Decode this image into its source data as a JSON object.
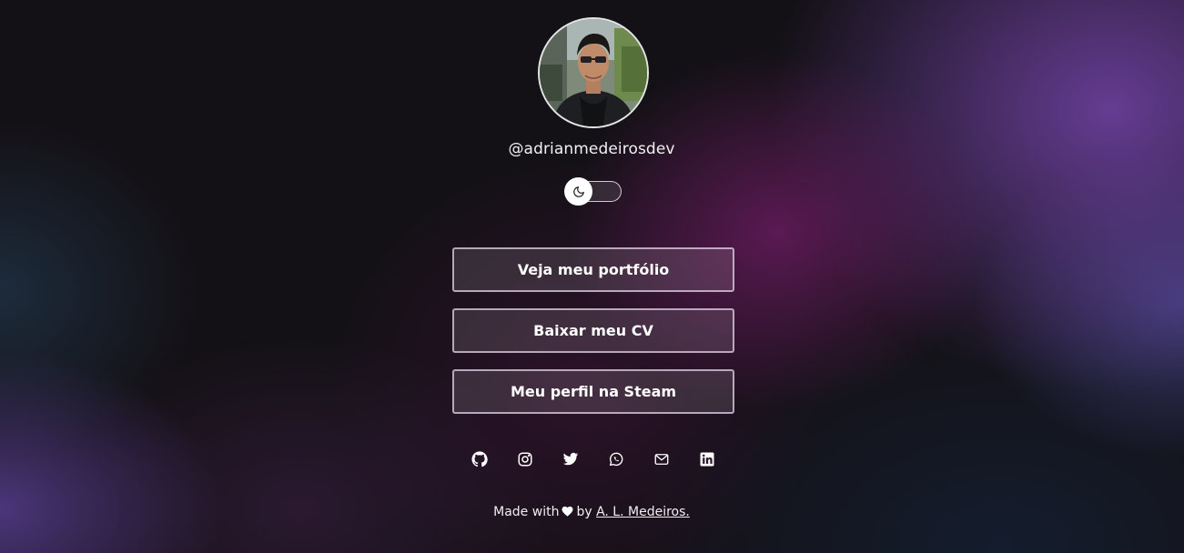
{
  "profile": {
    "username": "@adrianmedeirosdev"
  },
  "theme_toggle": {
    "icon": "moon-icon",
    "state": "dark"
  },
  "links": [
    {
      "label": "Veja meu portfólio"
    },
    {
      "label": "Baixar meu CV"
    },
    {
      "label": "Meu perfil na Steam"
    }
  ],
  "socials": [
    {
      "icon": "github-icon"
    },
    {
      "icon": "instagram-icon"
    },
    {
      "icon": "twitter-icon"
    },
    {
      "icon": "whatsapp-icon"
    },
    {
      "icon": "mail-icon"
    },
    {
      "icon": "linkedin-icon"
    }
  ],
  "footer": {
    "made_with": "Made with",
    "heart_icon": "heart-icon",
    "by": "by",
    "author": "A. L. Medeiros."
  },
  "colors": {
    "text": "#ffffff",
    "accent_purple": "#6e2a8a",
    "background_dark": "#141116"
  }
}
